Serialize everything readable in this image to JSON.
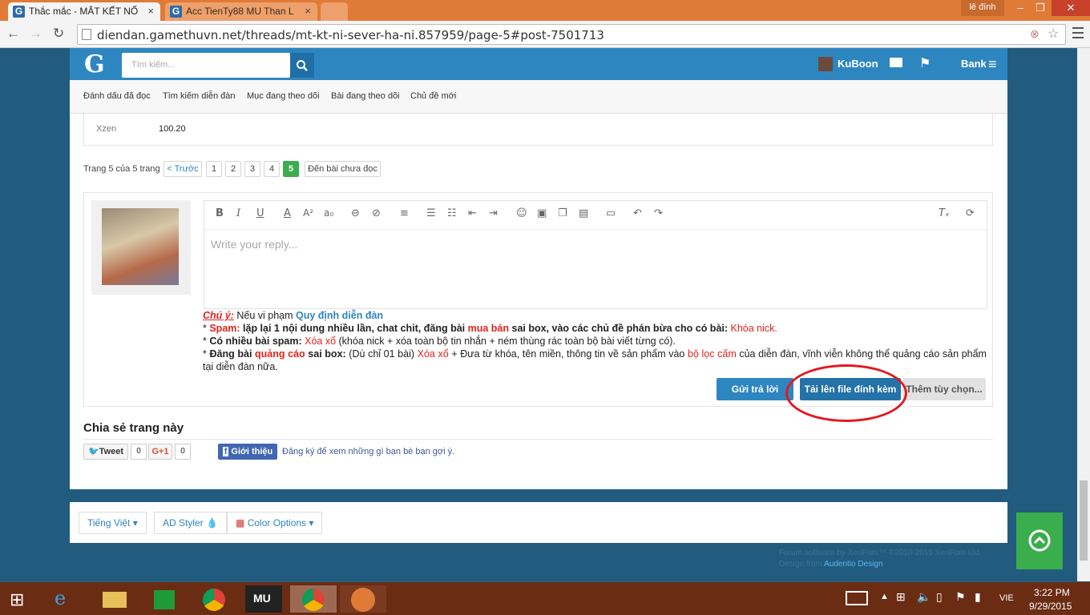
{
  "browser": {
    "tabs": [
      {
        "title": "Thắc mắc - MẮT KẾT NỐ",
        "active": true
      },
      {
        "title": "Acc TienTy88 MU Than L",
        "active": false
      }
    ],
    "user_chip": "lê đính",
    "url": "diendan.gamethuvn.net/threads/mt-kt-ni-sever-ha-ni.857959/page-5#post-7501713"
  },
  "header": {
    "logo": "G",
    "search_placeholder": "Tìm kiếm...",
    "username": "KuBoon",
    "bank": "Bank"
  },
  "nav": [
    "Đánh dấu đã đọc",
    "Tìm kiếm diễn đàn",
    "Mục đang theo dõi",
    "Bài đang theo dõi",
    "Chủ đề mới"
  ],
  "stat": {
    "label": "Xzen",
    "value": "100.20"
  },
  "pagination": {
    "summary": "Trang 5 của 5 trang",
    "prev": "< Trước",
    "pages": [
      "1",
      "2",
      "3",
      "4",
      "5"
    ],
    "current": "5",
    "unread": "Đến bài chưa đọc"
  },
  "editor": {
    "placeholder": "Write your reply..."
  },
  "rules": {
    "note_label": "Chú ý:",
    "note_text": " Nếu vi phạm ",
    "note_link": "Quy định diễn đàn",
    "l1_a": "* ",
    "l1_spam": "Spam:",
    "l1_b": " lặp lại 1 nội dung nhiều lần, chat chit, đăng bài ",
    "l1_mua": "mua bán",
    "l1_c": " sai box, vào các chủ đề phán bừa cho có bài: ",
    "l1_khoa": "Khóa nick.",
    "l2_a": "* ",
    "l2_b": "Có nhiều bài spam:",
    "l2_xoa": " Xóa xổ",
    "l2_c": " (khóa nick + xóa toàn bộ tin nhắn + ném thùng rác toàn bộ bài viết từng có).",
    "l3_a": "* ",
    "l3_b": "Đăng bài ",
    "l3_qc": "quảng cáo",
    "l3_c": " sai box:",
    "l3_d": " (Dù chỉ 01 bài) ",
    "l3_xoa": "Xóa xổ",
    "l3_e": " + Đưa từ khóa, tên miền, thông tin về sản phẩm vào ",
    "l3_loc": "bộ lọc cấm",
    "l3_f": " của diễn đàn, vĩnh viễn không thể quảng cáo sản phẩm tại diễn đàn nữa."
  },
  "buttons": {
    "reply": "Gửi trả lời",
    "upload": "Tải lên file đính kèm",
    "more": "Thêm tùy chọn..."
  },
  "share": {
    "heading": "Chia sẻ trang này",
    "tweet": "Tweet",
    "tweet_count": "0",
    "gplus": "G+1",
    "gplus_count": "0",
    "fb": "Giới thiệu",
    "fb_text": "Đăng ký để xem những gì bạn bè bạn gợi ý."
  },
  "footer": {
    "lang": "Tiếng Việt",
    "styler": "AD Styler",
    "color": "Color Options",
    "credit1": "Forum software by XenForo™ ©2010-2015 XenForo Ltd.",
    "credit2_a": "Design from ",
    "credit2_b": "Audentio Design"
  },
  "taskbar": {
    "lang": "VIE",
    "time": "3:22 PM",
    "date": "9/29/2015"
  },
  "colors": {
    "brand": "#2e86c1",
    "accent_green": "#3aad4d",
    "alert_red": "#e2231a",
    "taskbar": "#6b2c14"
  }
}
